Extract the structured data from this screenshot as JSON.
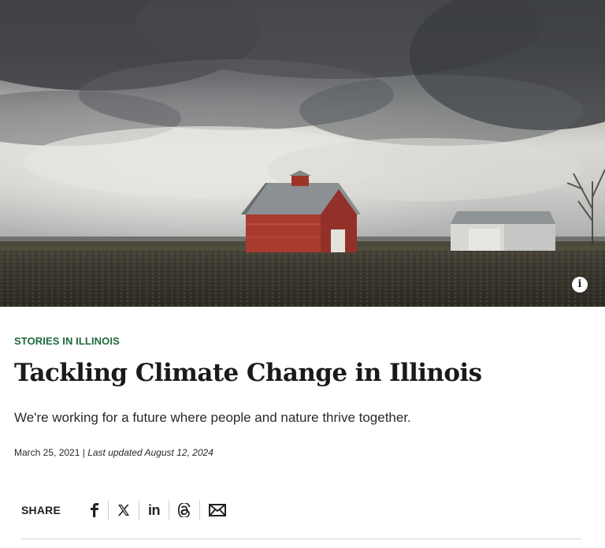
{
  "hero": {
    "info_icon": "info-icon",
    "info_glyph": "i"
  },
  "article": {
    "eyebrow": "STORIES IN ILLINOIS",
    "title": "Tackling Climate Change in Illinois",
    "subtitle": "We're working for a future where people and nature thrive together.",
    "date": "March 25, 2021",
    "separator": " | ",
    "updated": "Last updated August 12, 2024"
  },
  "share": {
    "label": "SHARE",
    "items": [
      {
        "name": "facebook",
        "icon": "facebook-icon"
      },
      {
        "name": "x",
        "icon": "x-icon"
      },
      {
        "name": "linkedin",
        "icon": "linkedin-icon",
        "glyph": "in"
      },
      {
        "name": "threads",
        "icon": "threads-icon"
      },
      {
        "name": "email",
        "icon": "email-icon"
      }
    ]
  },
  "colors": {
    "eyebrow": "#1f6a3c",
    "text": "#1a1a1a",
    "rule": "#d3d3d3"
  }
}
